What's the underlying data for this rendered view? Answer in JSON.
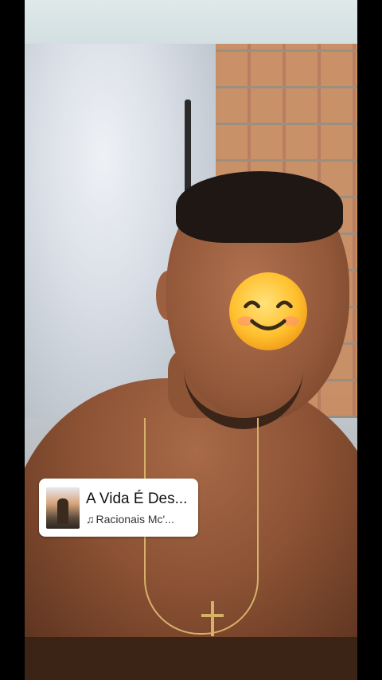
{
  "music_sticker": {
    "title": "A Vida É Des...",
    "artist": "Racionais Mc'...",
    "note_icon": "♫"
  },
  "colors": {
    "frame_background": "#000000",
    "top_bar": "#d3dfe0",
    "sticker_background": "#ffffff"
  },
  "icons": [
    "smiling-face-emoji",
    "music-note-icon",
    "album-cover"
  ]
}
